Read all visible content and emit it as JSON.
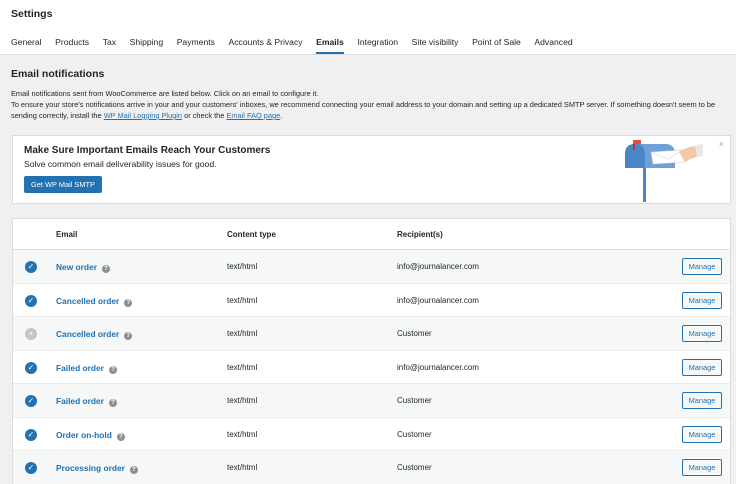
{
  "header": {
    "title": "Settings"
  },
  "tabs": [
    {
      "label": "General"
    },
    {
      "label": "Products"
    },
    {
      "label": "Tax"
    },
    {
      "label": "Shipping"
    },
    {
      "label": "Payments"
    },
    {
      "label": "Accounts & Privacy"
    },
    {
      "label": "Emails",
      "active": true
    },
    {
      "label": "Integration"
    },
    {
      "label": "Site visibility"
    },
    {
      "label": "Point of Sale"
    },
    {
      "label": "Advanced"
    }
  ],
  "section": {
    "title": "Email notifications",
    "intro_line1": "Email notifications sent from WooCommerce are listed below. Click on an email to configure it.",
    "intro_line2_a": "To ensure your store's notifications arrive in your and your customers' inboxes, we recommend connecting your email address to your domain and setting up a dedicated SMTP server. If something doesn't seem to be sending correctly, install the ",
    "intro_link1": "WP Mail Logging Plugin",
    "intro_line2_b": " or check the ",
    "intro_link2": "Email FAQ page",
    "intro_line2_c": "."
  },
  "banner": {
    "title": "Make Sure Important Emails Reach Your Customers",
    "subtitle": "Solve common email deliverability issues for good.",
    "button_label": "Get WP Mail SMTP",
    "close_glyph": "×"
  },
  "table": {
    "headers": {
      "email": "Email",
      "content_type": "Content type",
      "recipients": "Recipient(s)"
    },
    "rows": [
      {
        "enabled": true,
        "name": "New order",
        "content_type": "text/html",
        "recipient": "info@journalancer.com",
        "action": "Manage"
      },
      {
        "enabled": true,
        "name": "Cancelled order",
        "content_type": "text/html",
        "recipient": "info@journalancer.com",
        "action": "Manage"
      },
      {
        "enabled": false,
        "name": "Cancelled order",
        "content_type": "text/html",
        "recipient": "Customer",
        "action": "Manage"
      },
      {
        "enabled": true,
        "name": "Failed order",
        "content_type": "text/html",
        "recipient": "info@journalancer.com",
        "action": "Manage"
      },
      {
        "enabled": true,
        "name": "Failed order",
        "content_type": "text/html",
        "recipient": "Customer",
        "action": "Manage"
      },
      {
        "enabled": true,
        "name": "Order on-hold",
        "content_type": "text/html",
        "recipient": "Customer",
        "action": "Manage"
      },
      {
        "enabled": true,
        "name": "Processing order",
        "content_type": "text/html",
        "recipient": "Customer",
        "action": "Manage"
      }
    ]
  },
  "icons": {
    "enabled": "checkmark-icon",
    "disabled": "x-icon",
    "help": "help-icon",
    "mailbox": "mailbox-illustration"
  },
  "colors": {
    "accent": "#2271b1",
    "disabled": "#c3c4c7",
    "page_bg": "#f0f0f1"
  }
}
